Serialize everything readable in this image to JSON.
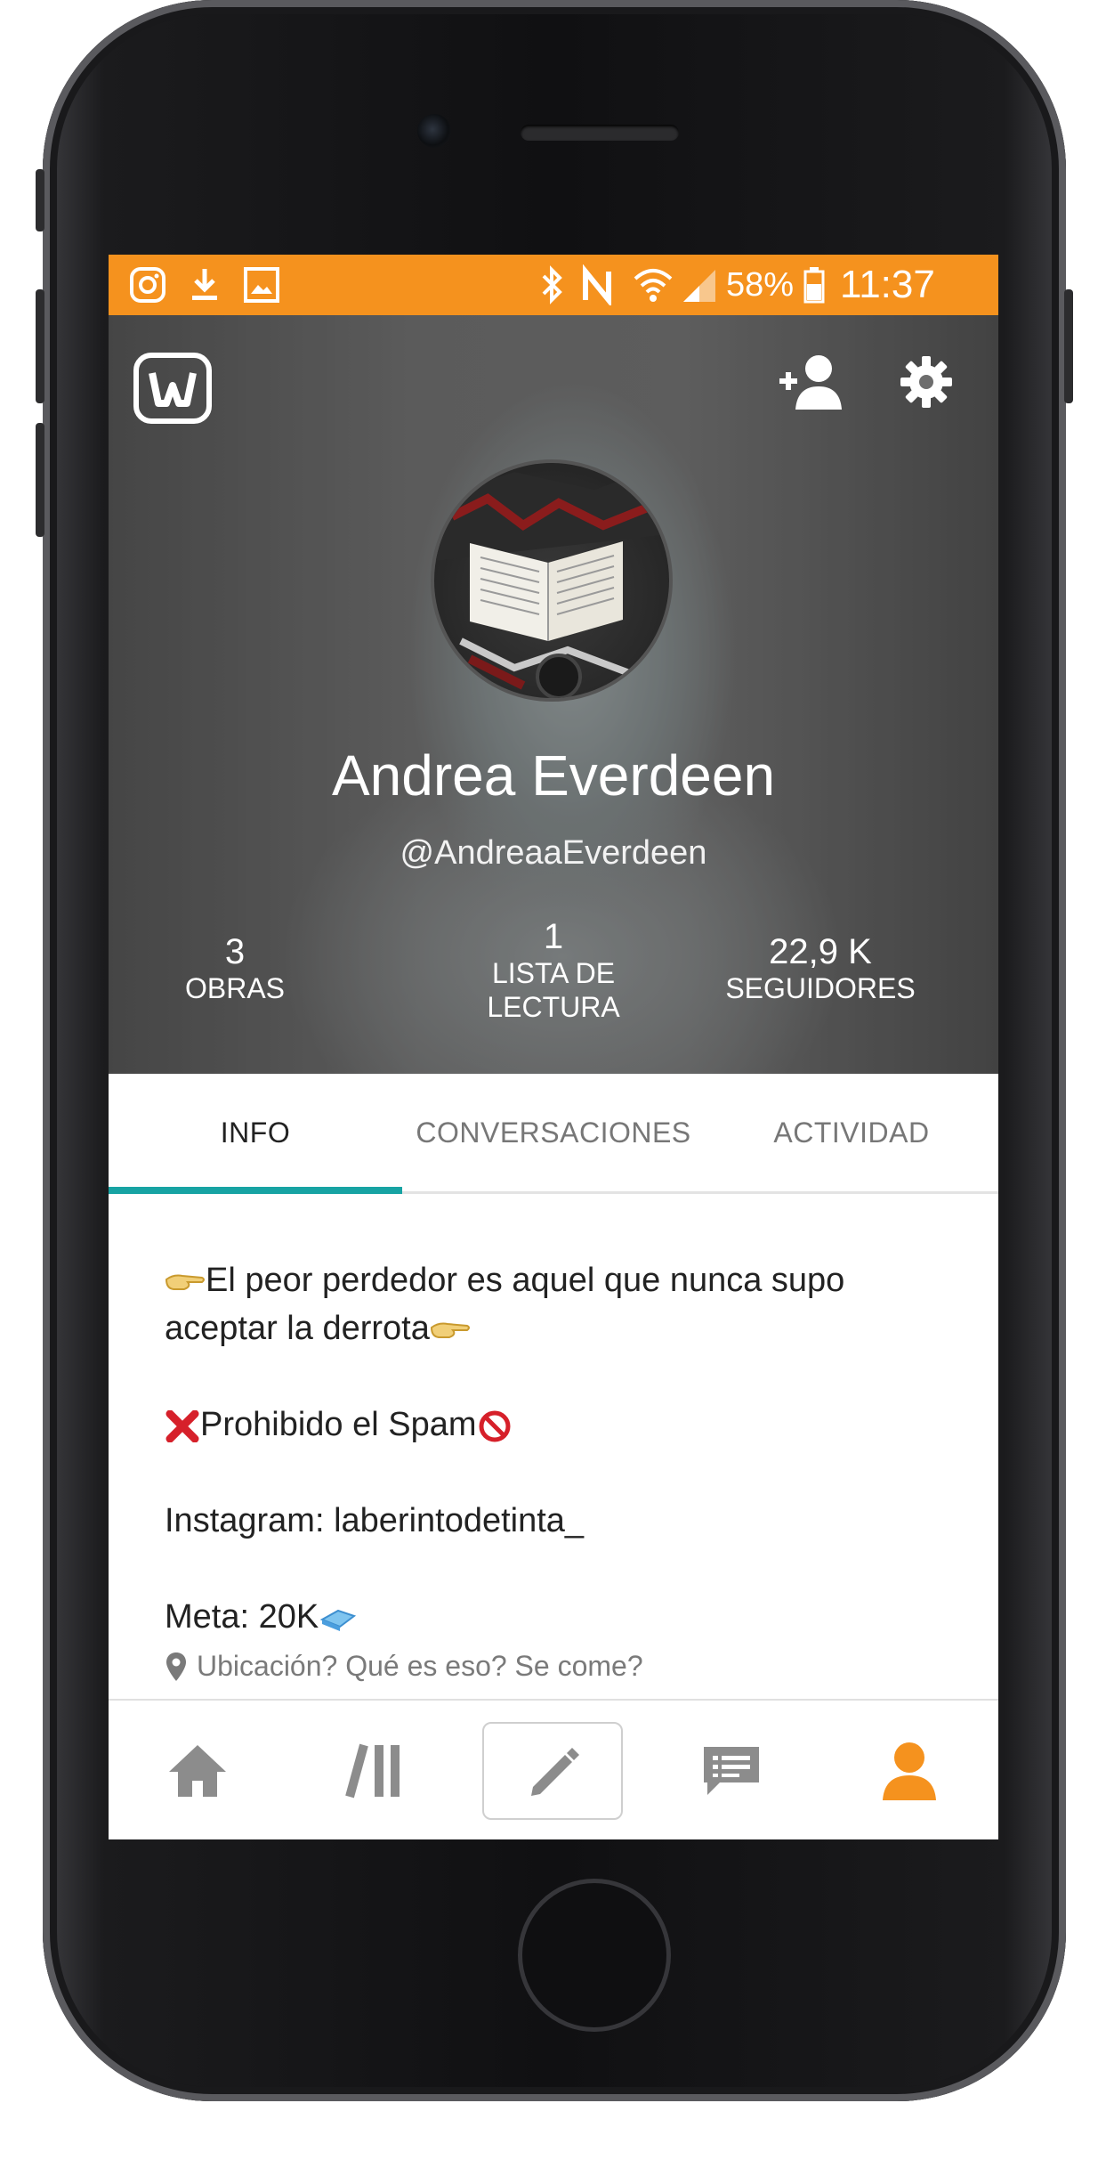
{
  "status_bar": {
    "battery": "58%",
    "time": "11:37",
    "icons": [
      "instagram-icon",
      "download-icon",
      "image-icon",
      "bluetooth-icon",
      "nfc-icon",
      "wifi-icon",
      "signal-icon",
      "battery-icon"
    ],
    "background": "#f5921e"
  },
  "profile": {
    "name": "Andrea Everdeen",
    "handle": "@AndreaaEverdeen",
    "stats": [
      {
        "value": "3",
        "label": "OBRAS"
      },
      {
        "value": "1",
        "label_line1": "LISTA DE",
        "label_line2": "LECTURA"
      },
      {
        "value": "22,9 K",
        "label": "SEGUIDORES"
      }
    ]
  },
  "tabs": [
    {
      "label": "INFO",
      "active": true
    },
    {
      "label": "CONVERSACIONES",
      "active": false
    },
    {
      "label": "ACTIVIDAD",
      "active": false
    }
  ],
  "accent": "#17a3a3",
  "bio": {
    "line1": "El peor perdedor es aquel que nunca supo",
    "line2": "aceptar la derrota",
    "spam": "Prohibido el Spam",
    "instagram": "Instagram: laberintodetinta_",
    "meta": "Meta: 20K",
    "location": "Ubicación? Qué es eso? Se come?"
  },
  "bottom_nav": {
    "items": [
      "home-icon",
      "library-icon",
      "write-icon",
      "messages-icon",
      "profile-icon"
    ],
    "active_color": "#f5921e"
  }
}
